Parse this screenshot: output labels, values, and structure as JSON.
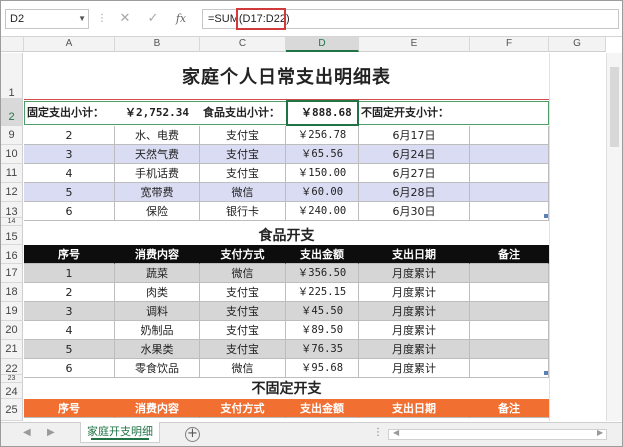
{
  "formula_bar": {
    "name_box": "D2",
    "formula_prefix": "=SUM",
    "formula_arg": "(D17:D22)",
    "cancel_icon": "✕",
    "enter_icon": "✓",
    "fx_icon": "fx"
  },
  "columns": [
    "A",
    "B",
    "C",
    "D",
    "E",
    "F",
    "G"
  ],
  "rows": [
    "1",
    "2",
    "9",
    "10",
    "11",
    "12",
    "13",
    "14",
    "15",
    "16",
    "17",
    "18",
    "19",
    "20",
    "21",
    "22",
    "23",
    "24",
    "25"
  ],
  "title": "家庭个人日常支出明细表",
  "summary": {
    "fixed_label": "固定支出小计：",
    "fixed_value": "￥2,752.34",
    "food_label": "食品支出小计：",
    "food_value": "￥888.68",
    "variable_label": "不固定开支小计："
  },
  "fixed_rows": [
    {
      "no": "2",
      "item": "水、电费",
      "pay": "支付宝",
      "amount": "￥256.78",
      "date": "6月17日"
    },
    {
      "no": "3",
      "item": "天然气费",
      "pay": "支付宝",
      "amount": "￥65.56",
      "date": "6月24日"
    },
    {
      "no": "4",
      "item": "手机话费",
      "pay": "支付宝",
      "amount": "￥150.00",
      "date": "6月27日"
    },
    {
      "no": "5",
      "item": "宽带费",
      "pay": "微信",
      "amount": "￥60.00",
      "date": "6月28日"
    },
    {
      "no": "6",
      "item": "保险",
      "pay": "银行卡",
      "amount": "￥240.00",
      "date": "6月30日"
    }
  ],
  "food": {
    "title": "食品开支",
    "headers": [
      "序号",
      "消费内容",
      "支付方式",
      "支出金额",
      "支出日期",
      "备注"
    ],
    "rows": [
      {
        "no": "1",
        "item": "蔬菜",
        "pay": "微信",
        "amount": "￥356.50",
        "date": "月度累计"
      },
      {
        "no": "2",
        "item": "肉类",
        "pay": "支付宝",
        "amount": "￥225.15",
        "date": "月度累计"
      },
      {
        "no": "3",
        "item": "调料",
        "pay": "支付宝",
        "amount": "￥45.50",
        "date": "月度累计"
      },
      {
        "no": "4",
        "item": "奶制品",
        "pay": "支付宝",
        "amount": "￥89.50",
        "date": "月度累计"
      },
      {
        "no": "5",
        "item": "水果类",
        "pay": "支付宝",
        "amount": "￥76.35",
        "date": "月度累计"
      },
      {
        "no": "6",
        "item": "零食饮品",
        "pay": "微信",
        "amount": "￥95.68",
        "date": "月度累计"
      }
    ]
  },
  "variable": {
    "title": "不固定开支",
    "headers": [
      "序号",
      "消费内容",
      "支付方式",
      "支出金额",
      "支出日期",
      "备注"
    ]
  },
  "sheet_tab": "家庭开支明细",
  "add_sheet": "+",
  "colors": {
    "excel_green": "#217346",
    "band_lavender": "#d9dcf2",
    "band_gray": "#d6d6d6",
    "header_black": "#0d0d0d",
    "header_orange": "#f06f31",
    "highlight_red": "#d13a3a"
  }
}
